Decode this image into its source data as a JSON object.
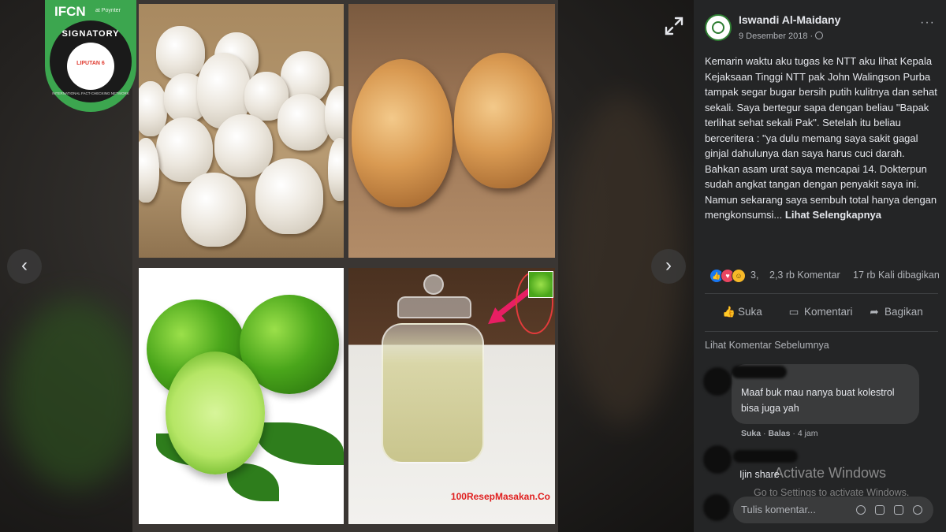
{
  "badge": {
    "logo": "IFCN",
    "poynter": "at Poynter",
    "signatory": "SIGNATORY",
    "organization": "LIPUTAN 6",
    "network": "INTERNATIONAL FACT-CHECKING NETWORK"
  },
  "viewer": {
    "prev_label": "‹",
    "next_label": "›",
    "watermark": "100ResepMasakan.Co"
  },
  "post": {
    "author": "Iswandi Al-Maidany",
    "date": "9 Desember 2018 ·",
    "more": "···",
    "body": "Kemarin waktu aku tugas ke NTT aku lihat Kepala Kejaksaan Tinggi NTT pak John Walingson Purba tampak segar bugar bersih putih kulitnya dan sehat sekali. Saya bertegur sapa dengan beliau \"Bapak terlihat sehat sekali Pak\". Setelah itu beliau berceritera : \"ya dulu memang saya sakit gagal ginjal dahulunya dan saya harus cuci darah. Bahkan asam urat saya mencapai 14. Dokterpun sudah angkat tangan dengan penyakit saya ini. Namun sekarang saya sembuh total hanya dengan mengkonsumsi...",
    "see_more": "Lihat Selengkapnya"
  },
  "reactions": {
    "count": "3,",
    "comments": "2,3 rb Komentar",
    "shares": "17 rb Kali dibagikan",
    "types": [
      "like",
      "love",
      "haha"
    ],
    "colors": {
      "like": "#1877f2",
      "love": "#e94560",
      "haha": "#f7b928"
    }
  },
  "actions": {
    "like": "Suka",
    "comment": "Komentari",
    "share": "Bagikan"
  },
  "comments": {
    "previous_label": "Lihat Komentar Sebelumnya",
    "items": [
      {
        "text": "Maaf buk mau nanya buat kolestrol bisa juga yah",
        "like": "Suka",
        "reply": "Balas",
        "time": "4 jam"
      },
      {
        "text": "Ijin share"
      }
    ],
    "write_placeholder": "Tulis komentar..."
  },
  "windows_overlay": {
    "title": "Activate Windows",
    "subtitle": "Go to Settings to activate Windows."
  },
  "icons": [
    "expand-icon",
    "globe-icon",
    "more-icon",
    "like-icon",
    "comment-icon",
    "share-icon",
    "emoji-icon",
    "camera-icon",
    "gif-icon",
    "sticker-icon"
  ]
}
